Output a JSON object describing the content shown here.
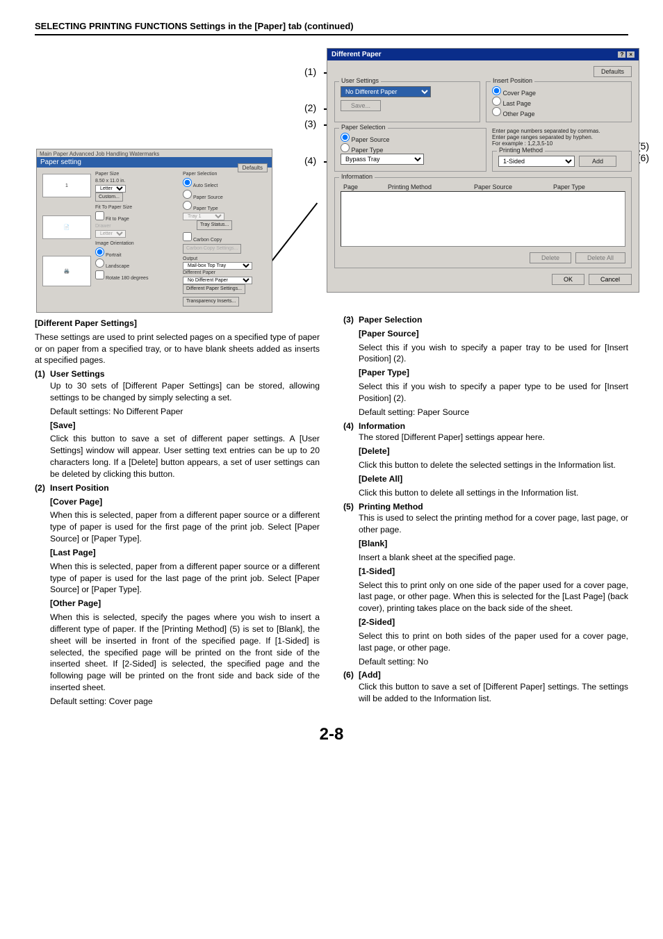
{
  "header": "SELECTING PRINTING FUNCTIONS Settings in the [Paper] tab (continued)",
  "callouts": {
    "c1": "(1)",
    "c2": "(2)",
    "c3": "(3)",
    "c4": "(4)",
    "c5": "(5)",
    "c6": "(6)"
  },
  "paperSetting": {
    "tabs": "Main  Paper  Advanced  Job Handling  Watermarks",
    "title": "Paper setting",
    "defaults": "Defaults",
    "thumbNum": "1",
    "paperSize": "Paper Size",
    "paperSizeVal": "8.50 x 11.0 in.",
    "paperSizeSel": "Letter",
    "custom": "Custom...",
    "fitLabel": "Fit To Paper Size",
    "fitCheck": "Fit to Page",
    "drawerLabel": "Drawer",
    "drawerSel": "Letter",
    "imgOrient": "Image Orientation",
    "portrait": "Portrait",
    "landscape": "Landscape",
    "rotate": "Rotate 180 degrees",
    "paperSelection": "Paper Selection",
    "autoSelect": "Auto Select",
    "paperSource": "Paper Source",
    "paperType": "Paper Type",
    "trayStatus": "Tray Status...",
    "carbonCopy": "Carbon Copy",
    "carbonSettings": "Carbon Copy Settings...",
    "output": "Output",
    "outputSel": "Mail-box Top Tray",
    "diffPaper": "Different Paper",
    "diffPaperSel": "No Different Paper",
    "diffPaperBtn": "Different Paper Settings...",
    "transBtn": "Transparency Inserts..."
  },
  "diffPaper": {
    "title": "Different Paper",
    "defaults": "Defaults",
    "userSettings": "User Settings",
    "userSettingsSel": "No Different Paper",
    "save": "Save...",
    "insertPosition": "Insert Position",
    "coverPage": "Cover Page",
    "lastPage": "Last Page",
    "otherPage": "Other Page",
    "pageHint1": "Enter page numbers separated by commas.",
    "pageHint2": "Enter page ranges separated by hyphen.",
    "pageHint3": "For example :  1,2,3,5-10",
    "paperSelection": "Paper Selection",
    "paperSource": "Paper Source",
    "paperType": "Paper Type",
    "bypass": "Bypass Tray",
    "printingMethod": "Printing Method",
    "printingMethodSel": "1-Sided",
    "add": "Add",
    "information": "Information",
    "h1": "Page",
    "h2": "Printing Method",
    "h3": "Paper Source",
    "h4": "Paper Type",
    "delete": "Delete",
    "deleteAll": "Delete All",
    "ok": "OK",
    "cancel": "Cancel"
  },
  "left": {
    "t0": "[Different Paper Settings]",
    "p0": "These settings are used to print selected pages on a specified type of paper or on paper from a specified tray, or to have blank sheets added as inserts at specified pages.",
    "n1": "(1)",
    "t1": "User Settings",
    "p1a": "Up to 30 sets of [Different Paper Settings] can be stored, allowing settings to be changed by simply selecting a set.",
    "p1b": "Default settings: No Different Paper",
    "t1s": "[Save]",
    "p1s": "Click this button to save a set of different paper settings. A [User Settings] window will appear. User setting text entries can be up to 20 characters long. If a [Delete] button appears, a set of user settings can be deleted by clicking this button.",
    "n2": "(2)",
    "t2": "Insert Position",
    "t2a": "[Cover Page]",
    "p2a": "When this is selected, paper from a different paper source or a different type of paper is used for the first page of the print job. Select [Paper Source] or [Paper Type].",
    "t2b": "[Last Page]",
    "p2b": "When this is selected, paper from a different paper source or a different type of paper is used for the last page of the print job. Select [Paper Source] or [Paper Type].",
    "t2c": "[Other Page]",
    "p2c": "When this is selected, specify the pages where you wish to insert a different type of paper. If the [Printing Method] (5) is set to [Blank], the sheet will be inserted in front of the specified page. If [1-Sided] is selected, the specified page will be printed on the front side of the inserted sheet. If [2-Sided] is selected, the specified page and the following page will be printed on the front side and back side of the inserted sheet.",
    "p2d": "Default setting: Cover page"
  },
  "right": {
    "n3": "(3)",
    "t3": "Paper Selection",
    "t3a": "[Paper Source]",
    "p3a": "Select this if you wish to specify a paper tray to be used for [Insert Position] (2).",
    "t3b": "[Paper Type]",
    "p3b": "Select this if you wish to specify a paper type to be used for [Insert Position] (2).",
    "p3c": "Default setting: Paper Source",
    "n4": "(4)",
    "t4": "Information",
    "p4a": "The stored [Different Paper] settings appear here.",
    "t4b": "[Delete]",
    "p4b": "Click this button to delete the selected settings in the Information list.",
    "t4c": "[Delete All]",
    "p4c": "Click this button to delete all settings in the Information list.",
    "n5": "(5)",
    "t5": "Printing Method",
    "p5a": "This is used to select the printing method for a cover page, last page, or other page.",
    "t5b": "[Blank]",
    "p5b": "Insert a blank sheet at the specified page.",
    "t5c": "[1-Sided]",
    "p5c": "Select this to print only on one side of the paper used for a cover page, last page, or other page. When this is selected for the [Last Page] (back cover), printing takes place on the back side of the sheet.",
    "t5d": "[2-Sided]",
    "p5d": "Select this to print on both sides of the paper used for a cover page, last page, or other page.",
    "p5e": "Default setting: No",
    "n6": "(6)",
    "t6": "[Add]",
    "p6a": "Click this button to save a set of [Different Paper] settings. The settings will be added to the Information list."
  },
  "pageNum": "2-8"
}
